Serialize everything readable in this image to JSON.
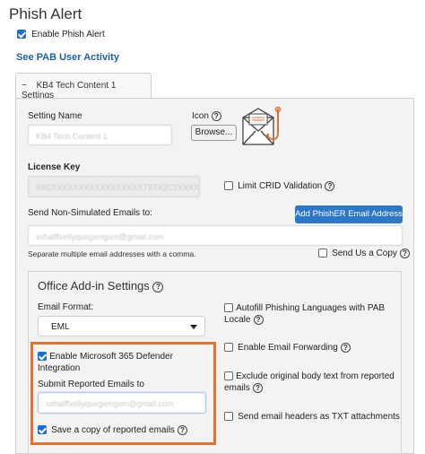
{
  "page": {
    "title": "Phish Alert",
    "enable_label": "Enable Phish Alert",
    "enable_checked": true,
    "activity_link": "See PAB User Activity"
  },
  "tab": {
    "toggle": "−",
    "label": "KB4 Tech Content 1 Settings"
  },
  "settings": {
    "setting_name_label": "Setting Name",
    "setting_name_value": "KB4 Tech Content 1",
    "icon_label": "Icon",
    "browse_label": "Browse...",
    "license_key_label": "License Key",
    "license_key_value": "8XCXXXXXXXXXXXXXXXXX7X7X2C2XXXX",
    "limit_crid_label": "Limit CRID Validation",
    "limit_crid_checked": false,
    "send_non_sim_label": "Send Non-Simulated Emails to:",
    "add_phisher_label": "Add PhishER Email Address",
    "non_sim_value": "xxhalffxellyquxgxmgxm@gmail.com",
    "separate_hint": "Separate multiple email addresses with a comma.",
    "send_copy_label": "Send Us a Copy",
    "send_copy_checked": false
  },
  "office": {
    "heading": "Office Add-in Settings",
    "email_format_label": "Email Format:",
    "email_format_value": "EML",
    "ms365_label": "Enable Microsoft 365 Defender Integration",
    "ms365_checked": true,
    "submit_label": "Submit Reported Emails to",
    "submit_value": "xxhalffxellyquxgxmgxm@gmail.com",
    "save_copy_label": "Save a copy of reported emails",
    "save_copy_checked": true,
    "autofill_label": "Autofill Phishing Languages with PAB Locale",
    "autofill_checked": false,
    "forwarding_label": "Enable Email Forwarding",
    "forwarding_checked": false,
    "exclude_label": "Exclude original body text from reported emails",
    "exclude_checked": false,
    "headers_label": "Send email headers as TXT attachments",
    "headers_checked": false
  },
  "colors": {
    "highlight": "#e47233",
    "primary": "#2d77c9",
    "link": "#1f5fa8"
  }
}
